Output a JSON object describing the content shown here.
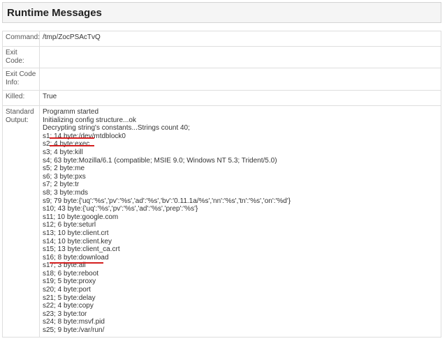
{
  "header": {
    "title": "Runtime Messages"
  },
  "rows": {
    "command": {
      "label": "Command:",
      "value": "/tmp/ZocPSAcTvQ"
    },
    "exit_code": {
      "label": "Exit Code:",
      "value": ""
    },
    "exit_code_info": {
      "label": "Exit Code Info:",
      "value": ""
    },
    "killed": {
      "label": "Killed:",
      "value": "True"
    },
    "standard_output": {
      "label": "Standard Output:",
      "lines": [
        "Programm started",
        "Initializing config structure...ok",
        "Decrypting string's constants...Strings count 40;",
        "s1; 14 byte:/dev/mtdblock0",
        "s2; 4 byte:exec",
        "s3; 4 byte:kill",
        "s4; 63 byte:Mozilla/6.1 (compatible; MSIE 9.0; Windows NT 5.3; Trident/5.0)",
        "s5; 2 byte:me",
        "s6; 3 byte:pxs",
        "s7; 2 byte:tr",
        "s8; 3 byte:mds",
        "s9; 79 byte:{'uq':'%s','pv':'%s','ad':'%s','bv':'0.11.1a/%s','nn':'%s','tn':'%s','on':'%d'}",
        "s10; 43 byte:{'uq':'%s','pv':'%s','ad':'%s','prep':'%s'}",
        "s11; 10 byte:google.com",
        "s12; 6 byte:seturl",
        "s13; 10 byte:client.crt",
        "s14; 10 byte:client.key",
        "s15; 13 byte:client_ca.crt",
        "s16; 8 byte:download",
        "s17; 3 byte:all",
        "s18; 6 byte:reboot",
        "s19; 5 byte:proxy",
        "s20; 4 byte:port",
        "s21; 5 byte:delay",
        "s22; 4 byte:copy",
        "s23; 3 byte:tor",
        "s24; 8 byte:msvf.pid",
        "s25; 9 byte:/var/run/"
      ]
    }
  },
  "highlight_color": "#d41f1f"
}
